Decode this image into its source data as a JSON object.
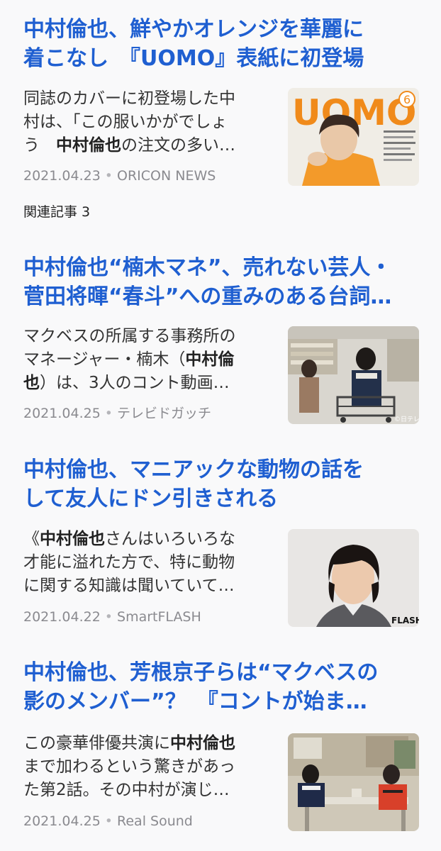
{
  "articles": [
    {
      "title_lines": [
        "中村倫也、鮮やかオレンジを華麗に",
        "着こなし　『UOMO』表紙に初登場"
      ],
      "snippet_lines": [
        [
          {
            "t": "同誌のカバーに初登場した中",
            "b": false
          }
        ],
        [
          {
            "t": "村は、「この服いかがでしょ",
            "b": false
          }
        ],
        [
          {
            "t": "う　",
            "b": false
          },
          {
            "t": "中村倫也",
            "b": true
          },
          {
            "t": "の注文の多い…",
            "b": false
          }
        ]
      ],
      "date": "2021.04.23",
      "source": "ORICON NEWS",
      "thumb": {
        "type": "magazine",
        "masthead": "UOMO",
        "issue": "6"
      }
    },
    {
      "title_lines": [
        "中村倫也“楠木マネ”、売れない芸人・",
        "菅田将暉“春斗”への重みのある台詞…"
      ],
      "snippet_lines": [
        [
          {
            "t": "マクベスの所属する事務所の",
            "b": false
          }
        ],
        [
          {
            "t": "マネージャー・楠木（",
            "b": false
          },
          {
            "t": "中村倫",
            "b": true
          }
        ],
        [
          {
            "t": "也",
            "b": true
          },
          {
            "t": "）は、3人のコント動画…",
            "b": false
          }
        ]
      ],
      "date": "2021.04.25",
      "source": "テレビドガッチ",
      "thumb": {
        "type": "store",
        "watermark": "©日テレ"
      }
    },
    {
      "title_lines": [
        "中村倫也、マニアックな動物の話を",
        "して友人にドン引きされる"
      ],
      "snippet_lines": [
        [
          {
            "t": "《",
            "b": false
          },
          {
            "t": "中村倫也",
            "b": true
          },
          {
            "t": "さんはいろいろな",
            "b": false
          }
        ],
        [
          {
            "t": "才能に溢れた方で、特に動物",
            "b": false
          }
        ],
        [
          {
            "t": "に関する知識は聞いていて…",
            "b": false
          }
        ]
      ],
      "date": "2021.04.22",
      "source": "SmartFLASH",
      "thumb": {
        "type": "portrait",
        "watermark": "FLASH"
      }
    },
    {
      "title_lines": [
        "中村倫也、芳根京子らは“マクベスの",
        "影のメンバー”？　『コントが始ま…"
      ],
      "snippet_lines": [
        [
          {
            "t": "この豪華俳優共演に",
            "b": false
          },
          {
            "t": "中村倫也",
            "b": true
          }
        ],
        [
          {
            "t": "まで加わるという驚きがあっ",
            "b": false
          }
        ],
        [
          {
            "t": "た第2話。その中村が演じ…",
            "b": false
          }
        ]
      ],
      "date": "2021.04.25",
      "source": "Real Sound",
      "thumb": {
        "type": "room"
      }
    }
  ],
  "related": {
    "label": "関連記事 3"
  },
  "colors": {
    "title": "#1f5fd1",
    "background": "#f9f9fa",
    "meta": "#8a8a8f"
  }
}
